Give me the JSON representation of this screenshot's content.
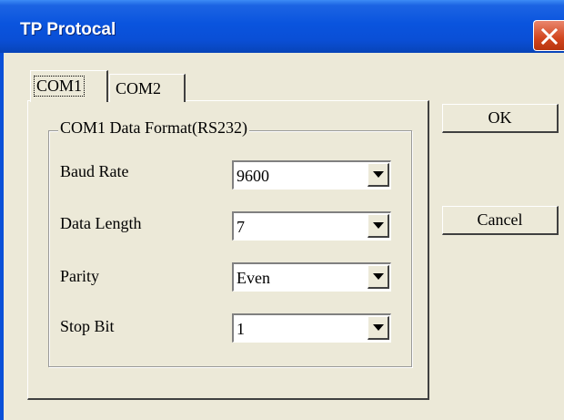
{
  "window": {
    "title": "TP Protocal"
  },
  "tabs": [
    {
      "label": "COM1",
      "selected": true
    },
    {
      "label": "COM2",
      "selected": false
    }
  ],
  "group": {
    "title": "COM1 Data Format(RS232)"
  },
  "fields": [
    {
      "label": "Baud Rate",
      "value": "9600"
    },
    {
      "label": "Data Length",
      "value": "7"
    },
    {
      "label": "Parity",
      "value": "Even"
    },
    {
      "label": "Stop Bit",
      "value": "1"
    }
  ],
  "buttons": {
    "ok": "OK",
    "cancel": "Cancel"
  },
  "colors": {
    "titlebar": "#0a54de",
    "close": "#d2451e",
    "face": "#ece9d8"
  },
  "icons": {
    "close": "close-icon",
    "dropdown": "chevron-down-icon"
  }
}
